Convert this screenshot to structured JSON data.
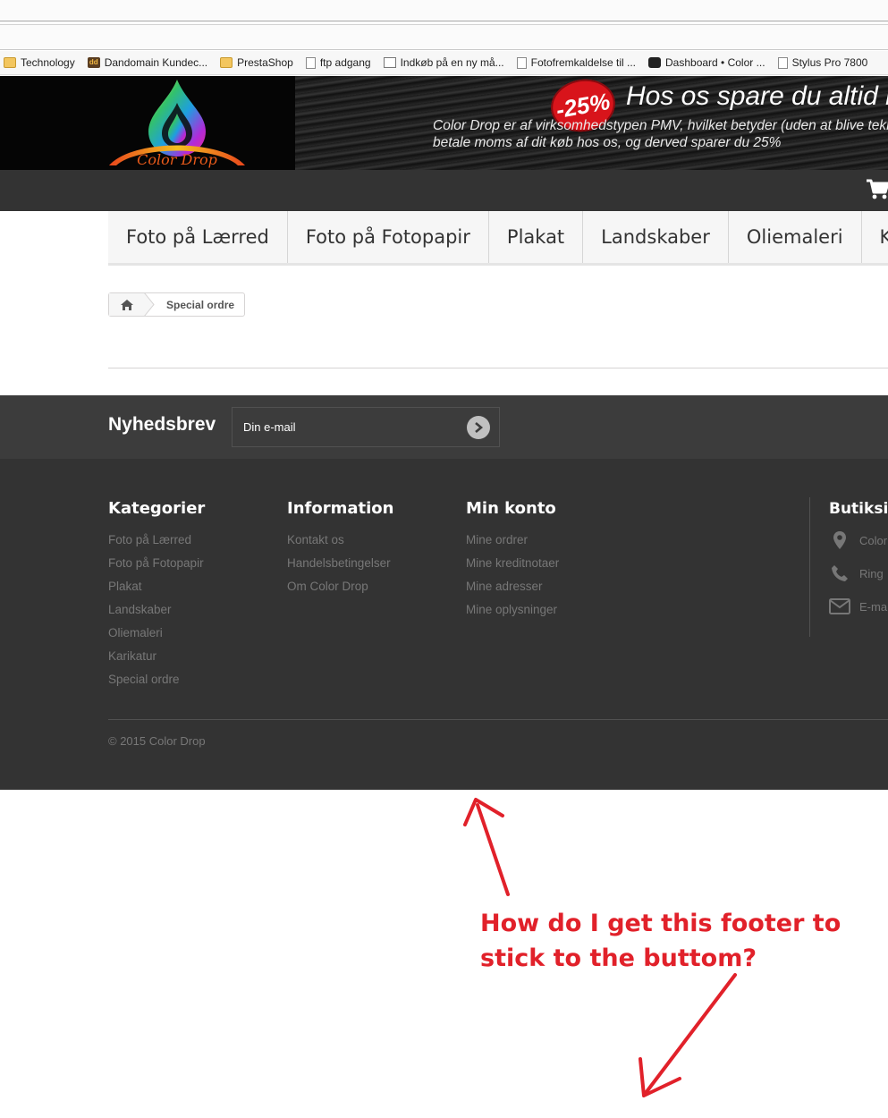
{
  "bookmarks": [
    {
      "label": "Technology",
      "icon": "folder-icon"
    },
    {
      "label": "Dandomain Kundec...",
      "icon": "dandomain-icon"
    },
    {
      "label": "PrestaShop",
      "icon": "folder-icon"
    },
    {
      "label": "ftp adgang",
      "icon": "page-icon"
    },
    {
      "label": "Indkøb på en ny må...",
      "icon": "mail-icon"
    },
    {
      "label": "Fotofremkaldelse til ...",
      "icon": "page-icon"
    },
    {
      "label": "Dashboard • Color ...",
      "icon": "dashboard-icon"
    },
    {
      "label": "Stylus Pro 7800",
      "icon": "page-icon"
    }
  ],
  "header": {
    "logo_text": "Color Drop",
    "badge": "-25%",
    "headline": "Hos os spare du altid m",
    "subline_1": "Color Drop er af virksomhedstypen PMV, hvilket betyder (uden at blive teknis",
    "subline_2": "betale moms af dit køb hos os, og derved sparer du 25%"
  },
  "menu": [
    "Foto på Lærred",
    "Foto på Fotopapir",
    "Plakat",
    "Landskaber",
    "Oliemaleri",
    "Karika"
  ],
  "breadcrumb": {
    "current": "Special ordre"
  },
  "newsletter": {
    "title": "Nyhedsbrev",
    "placeholder": "Din e-mail"
  },
  "footer": {
    "kategorier": {
      "title": "Kategorier",
      "links": [
        "Foto på Lærred",
        "Foto på Fotopapir",
        "Plakat",
        "Landskaber",
        "Oliemaleri",
        "Karikatur",
        "Special ordre"
      ]
    },
    "information": {
      "title": "Information",
      "links": [
        "Kontakt os",
        "Handelsbetingelser",
        "Om Color Drop"
      ]
    },
    "min_konto": {
      "title": "Min konto",
      "links": [
        "Mine ordrer",
        "Mine kreditnotaer",
        "Mine adresser",
        "Mine oplysninger"
      ]
    },
    "store": {
      "title": "Butiksin",
      "address": "Color",
      "phone": "Ring",
      "email": "E-ma"
    },
    "copyright": "© 2015 Color Drop"
  },
  "annotation": {
    "line_1": "How do I get this footer to",
    "line_2": "stick to the buttom?",
    "color": "#e1212a"
  },
  "colors": {
    "topbar": "#333333",
    "newsletter": "#3c3c3c",
    "footer": "#333333",
    "badge": "#d8141b"
  }
}
